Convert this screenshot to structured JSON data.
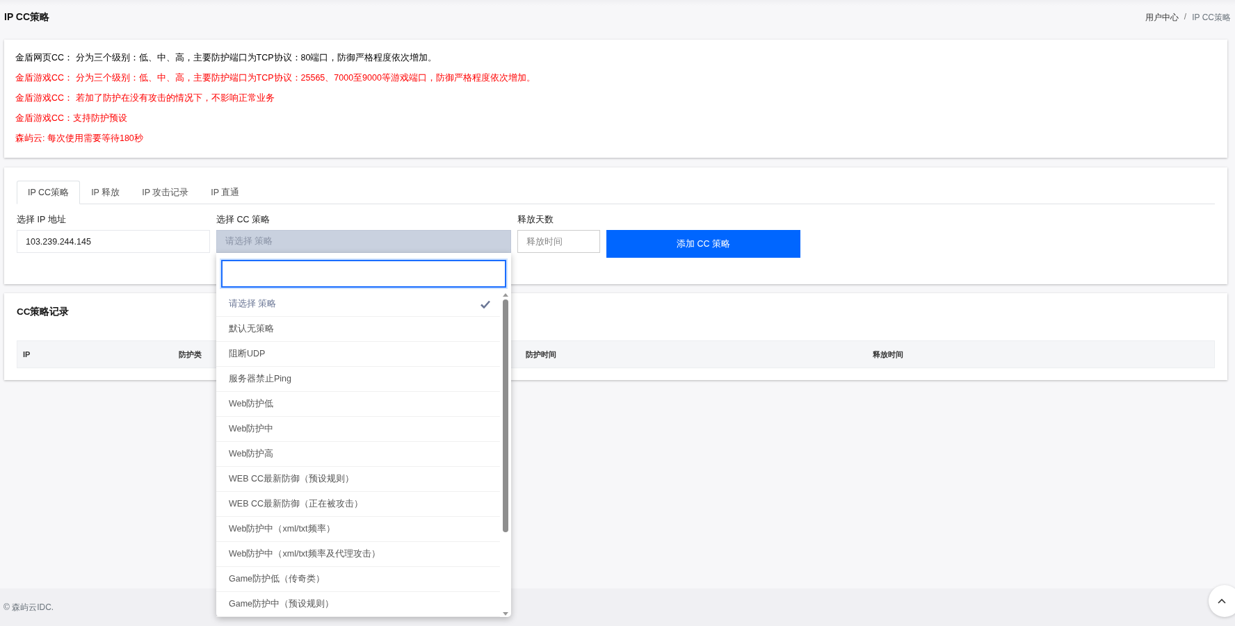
{
  "header": {
    "title": "IP CC策略",
    "breadcrumb": [
      {
        "label": "用户中心",
        "selected": false
      },
      {
        "label": "IP CC策略",
        "selected": true
      }
    ],
    "separator": "/"
  },
  "notices": [
    {
      "text": "金盾网页CC：  分为三个级别：低、中、高，主要防护端口为TCP协议：80端口，防御严格程度依次增加。",
      "color": "#000000"
    },
    {
      "text": "金盾游戏CC：  分为三个级别：低、中、高，主要防护端口为TCP协议：25565、7000至9000等游戏端口，防御严格程度依次增加。",
      "color": "#ff0000"
    },
    {
      "text": "金盾游戏CC：  若加了防护在没有攻击的情况下，不影响正常业务",
      "color": "#ff0000"
    },
    {
      "text": "金盾游戏CC：支持防护预设",
      "color": "#ff0000"
    },
    {
      "text": "森屿云: 每次使用需要等待180秒",
      "color": "#ff0000"
    }
  ],
  "tabs": [
    {
      "label": "IP CC策略",
      "selected": true
    },
    {
      "label": "IP 释放",
      "selected": false
    },
    {
      "label": "IP 攻击记录",
      "selected": false
    },
    {
      "label": "IP 直通",
      "selected": false
    }
  ],
  "form": {
    "ip": {
      "label": "选择 IP 地址",
      "value": "103.239.244.145"
    },
    "policy": {
      "label": "选择 CC 策略",
      "placeholder": "请选择 策略",
      "expanded": true,
      "options": [
        {
          "label": "请选择 策略",
          "selected": true
        },
        {
          "label": "默认无策略",
          "selected": false
        },
        {
          "label": "阻断UDP",
          "selected": false
        },
        {
          "label": "服务器禁止Ping",
          "selected": false
        },
        {
          "label": "Web防护低",
          "selected": false
        },
        {
          "label": "Web防护中",
          "selected": false
        },
        {
          "label": "Web防护高",
          "selected": false
        },
        {
          "label": "WEB CC最新防御（预设规则）",
          "selected": false
        },
        {
          "label": "WEB CC最新防御（正在被攻击）",
          "selected": false
        },
        {
          "label": "Web防护中（xml/txt频率）",
          "selected": false
        },
        {
          "label": "Web防护中（xml/txt频率及代理攻击）",
          "selected": false
        },
        {
          "label": "Game防护低（传奇类）",
          "selected": false
        },
        {
          "label": "Game防护中（预设规则）",
          "selected": false
        }
      ]
    },
    "days": {
      "label": "释放天数",
      "placeholder": "释放时间"
    },
    "submit": "添加 CC 策略"
  },
  "records": {
    "title": "CC策略记录",
    "columns": [
      "IP",
      "防护类",
      "",
      "防护时间",
      "释放时间"
    ]
  },
  "footer": {
    "copyright": "© 森屿云IDC."
  }
}
